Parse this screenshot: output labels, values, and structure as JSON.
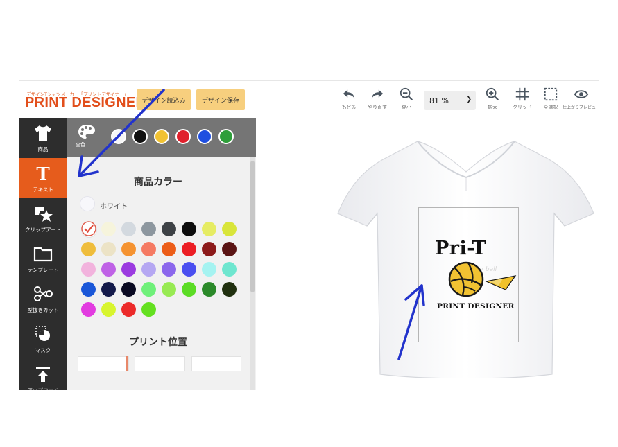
{
  "header": {
    "brand_tagline": "デザインTシャツメーカー「プリントデザイナー」",
    "brand_title": "PRINT DESIGNER",
    "load_design_label": "デザイン読込み",
    "save_design_label": "デザイン保存",
    "zoom_value": "81 %",
    "tools": [
      {
        "label": "もどる",
        "icon": "undo-icon"
      },
      {
        "label": "やり直す",
        "icon": "redo-icon"
      },
      {
        "label": "縮小",
        "icon": "zoom-out-icon"
      },
      {
        "label": "拡大",
        "icon": "zoom-in-icon"
      },
      {
        "label": "グリッド",
        "icon": "grid-icon"
      },
      {
        "label": "全選択",
        "icon": "select-all-icon"
      },
      {
        "label": "仕上がりプレビュー",
        "icon": "preview-icon"
      }
    ]
  },
  "sidebar": {
    "items": [
      {
        "label": "商品",
        "icon": "tshirt-icon"
      },
      {
        "label": "テキスト",
        "icon": "text-icon"
      },
      {
        "label": "クリップアート",
        "icon": "clipart-icon"
      },
      {
        "label": "テンプレート",
        "icon": "folder-icon"
      },
      {
        "label": "型抜きカット",
        "icon": "scissors-icon"
      },
      {
        "label": "マスク",
        "icon": "mask-icon"
      },
      {
        "label": "アップロード",
        "icon": "upload-icon"
      }
    ],
    "active_index": 1,
    "active_color": "#e65c1c"
  },
  "panel": {
    "palette_label": "全色",
    "recent_colors": [
      "#f7f7f7",
      "#111111",
      "#f1c232",
      "#e0202c",
      "#1f4fe0",
      "#2e9e3a"
    ],
    "product_color_title": "商品カラー",
    "selected_color_name": "ホワイト",
    "swatches": [
      "#ffffff",
      "#f6f4dc",
      "#d3d9df",
      "#8d979f",
      "#3e4246",
      "#0d0d0d",
      "#e6ec63",
      "#d9e53a",
      "#efbd3c",
      "#ece3c6",
      "#f59331",
      "#f57a63",
      "#ec5d18",
      "#ec1e24",
      "#8c1a1a",
      "#5a1414",
      "#f2b3dd",
      "#bf62e6",
      "#9b3be0",
      "#b5a7f2",
      "#8b67ec",
      "#4b4ff0",
      "#a5f3f1",
      "#6ee6cf",
      "#1a57d8",
      "#141a4a",
      "#0a0a22",
      "#6ff07a",
      "#98ea53",
      "#5cdc25",
      "#2b8a2a",
      "#20300f",
      "#e23be0",
      "#d8f52e",
      "#ec2a2a",
      "#64e020"
    ],
    "print_position_title": "プリント位置"
  },
  "canvas": {
    "design_title": "Pri-T",
    "design_subtitle": "PRINT DESIGNER",
    "design_faint_text": "Volley ball"
  },
  "colors": {
    "brand_orange": "#e24f1c",
    "button_yellow": "#f7cf7e",
    "annotation_arrow": "#2233cc"
  }
}
